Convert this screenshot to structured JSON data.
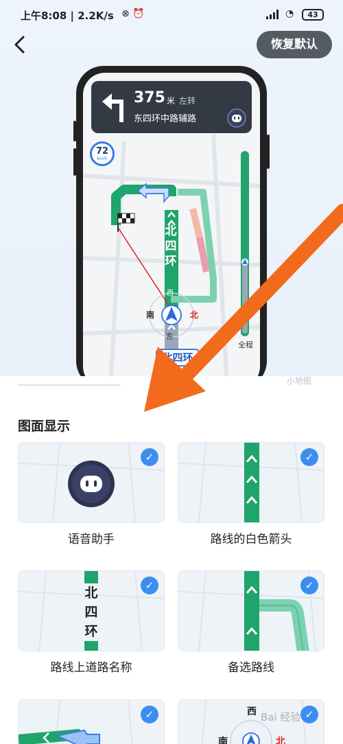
{
  "status_bar": {
    "time_speed": "上午8:08 | 2.2K/s",
    "battery": "43"
  },
  "header": {
    "reset_label": "恢复默认"
  },
  "preview": {
    "distance": "375",
    "distance_unit": "米",
    "turn_text": "左转",
    "road_name": "东四环中路辅路",
    "speed_limit": "72",
    "speed_unit": "km/h",
    "road_vertical": [
      "北",
      "四",
      "环"
    ],
    "west": "西",
    "south": "南",
    "north": "北",
    "east": "东",
    "road_tag": "北四环",
    "progress_label": "全程"
  },
  "tabs": {
    "partial_left": "",
    "partial_right": "小地图"
  },
  "section": {
    "title": "图面显示"
  },
  "cards": [
    {
      "label": "语音助手",
      "checked": true
    },
    {
      "label": "路线的白色箭头",
      "checked": true
    },
    {
      "label": "路线上道路名称",
      "checked": true
    },
    {
      "label": "备选路线",
      "checked": true
    },
    {
      "label": "",
      "checked": true
    },
    {
      "label": "",
      "checked": true
    }
  ],
  "card_extra": {
    "road_vertical": [
      "北",
      "四",
      "环"
    ],
    "compass_west": "西",
    "compass_south": "南",
    "compass_north": "北"
  },
  "watermark": "Bai 经验",
  "colors": {
    "accent_blue": "#3b8ef0",
    "route_green": "#1fa46b",
    "overlay_orange": "#f26a1b",
    "reset_button_bg": "#555b63"
  }
}
